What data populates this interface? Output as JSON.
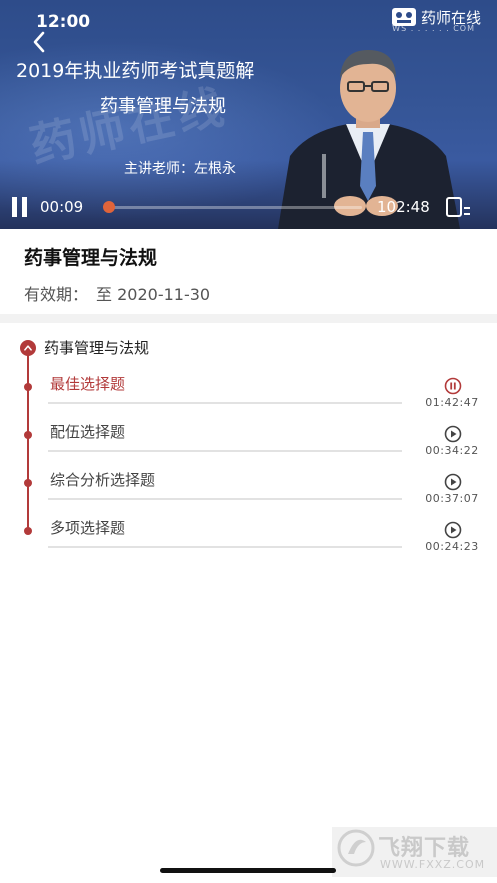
{
  "status_bar": {
    "time": "12:00"
  },
  "brand": {
    "name": "药师在线",
    "sub": "WS . . . . . . COM"
  },
  "video": {
    "slide_title": "2019年执业药师考试真题解",
    "slide_subtitle": "药事管理与法规",
    "watermark": "药师在线",
    "teacher": "主讲老师：左根永",
    "current_time": "00:09",
    "total_time": "102:48",
    "progress": 0.0015,
    "accent_color": "#e0643a"
  },
  "course": {
    "title": "药事管理与法规",
    "validity_label": "有效期：",
    "validity_value": "至 2020-11-30"
  },
  "chapter": {
    "title": "药事管理与法规",
    "expanded": true,
    "accent_color": "#b23a3a",
    "lessons": [
      {
        "name": "最佳选择题",
        "duration": "01:42:47",
        "state": "playing",
        "icon": "pause-circle-icon"
      },
      {
        "name": "配伍选择题",
        "duration": "00:34:22",
        "state": "idle",
        "icon": "play-circle-icon"
      },
      {
        "name": "综合分析选择题",
        "duration": "00:37:07",
        "state": "idle",
        "icon": "play-circle-icon"
      },
      {
        "name": "多项选择题",
        "duration": "00:24:23",
        "state": "idle",
        "icon": "play-circle-icon"
      }
    ]
  },
  "site_watermark": {
    "name": "飞翔下载",
    "url": "WWW.FXXZ.COM"
  }
}
